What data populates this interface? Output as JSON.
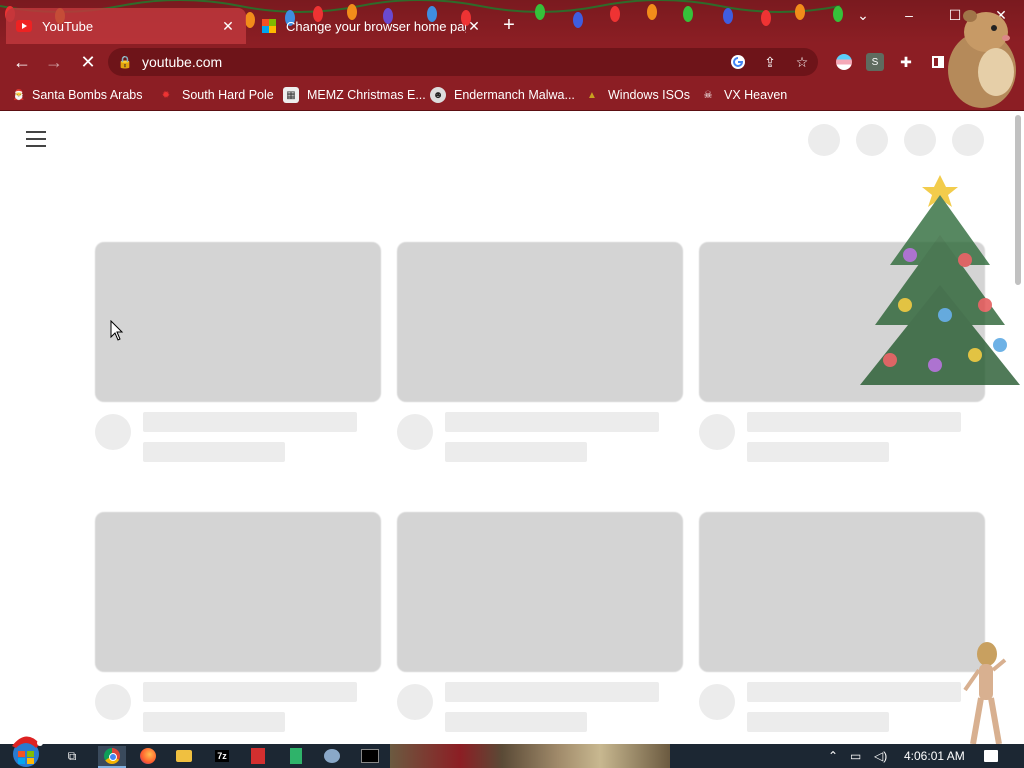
{
  "browser": {
    "tabs": [
      {
        "title": "YouTube",
        "active": true,
        "icon": "youtube-favicon"
      },
      {
        "title": "Change your browser home pag",
        "active": false,
        "icon": "microsoft-favicon"
      }
    ],
    "new_tab_label": "+",
    "window_controls": {
      "dropdown": "⌄",
      "minimize": "–",
      "maximize": "☐",
      "close": "✕"
    },
    "address_bar": {
      "url": "youtube.com"
    },
    "bookmarks": [
      {
        "label": "Santa Bombs Arabs",
        "icon": "bookmark-icon"
      },
      {
        "label": "South Hard Pole",
        "icon": "maple-leaf-icon"
      },
      {
        "label": "MEMZ Christmas E...",
        "icon": "image-icon"
      },
      {
        "label": "Endermanch Malwa...",
        "icon": "raccoon-icon"
      },
      {
        "label": "Windows ISOs",
        "icon": "folder-icon"
      },
      {
        "label": "VX Heaven",
        "icon": "skull-icon"
      }
    ],
    "extension_avatar_letter": "S"
  },
  "taskbar": {
    "clock": "4:06:01 AM",
    "apps": [
      {
        "name": "task-view",
        "glyph": "⧉"
      },
      {
        "name": "chrome",
        "glyph": "●"
      },
      {
        "name": "firefox",
        "glyph": "●"
      },
      {
        "name": "file-explorer",
        "glyph": "▬"
      },
      {
        "name": "7zip",
        "glyph": "7z"
      },
      {
        "name": "dev-cpp",
        "glyph": "C"
      },
      {
        "name": "notepad",
        "glyph": "▤"
      },
      {
        "name": "paint",
        "glyph": "✎"
      },
      {
        "name": "terminal",
        "glyph": "▭"
      }
    ]
  },
  "colors": {
    "frame": "#8c1e24",
    "skeleton_thumb": "#d4d4d4",
    "skeleton_line": "#ececec"
  }
}
